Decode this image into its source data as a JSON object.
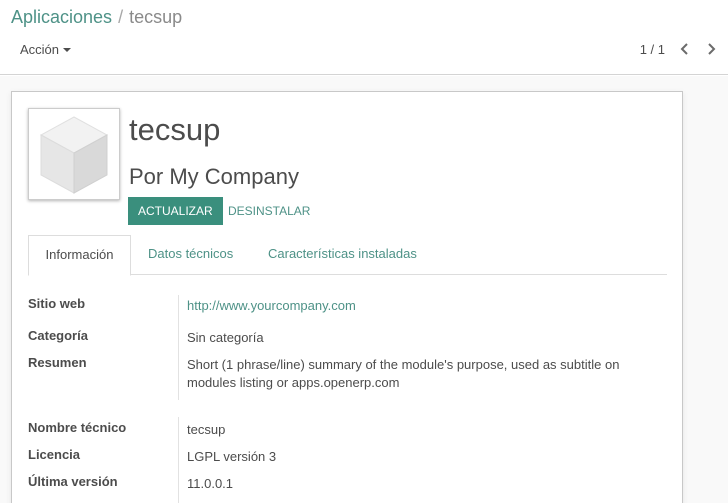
{
  "breadcrumb": {
    "parent": "Aplicaciones",
    "separator": "/",
    "current": "tecsup"
  },
  "toolbar": {
    "action_label": "Acción"
  },
  "pager": {
    "value": "1 / 1"
  },
  "module": {
    "name": "tecsup",
    "author": "Por My Company",
    "upgrade_label": "ACTUALIZAR",
    "uninstall_label": "DESINSTALAR"
  },
  "tabs": [
    {
      "label": "Información",
      "active": true
    },
    {
      "label": "Datos técnicos",
      "active": false
    },
    {
      "label": "Características instaladas",
      "active": false
    }
  ],
  "info": {
    "website_label": "Sitio web",
    "website_value": "http://www.yourcompany.com",
    "category_label": "Categoría",
    "category_value": "Sin categoría",
    "summary_label": "Resumen",
    "summary_value": "Short (1 phrase/line) summary of the module's purpose, used as subtitle on modules listing or apps.openerp.com",
    "technical_name_label": "Nombre técnico",
    "technical_name_value": "tecsup",
    "license_label": "Licencia",
    "license_value": "LGPL versión 3",
    "latest_version_label": "Última versión",
    "latest_version_value": "11.0.0.1"
  },
  "colors": {
    "accent": "#3a8f7d",
    "link": "#4e9287"
  }
}
